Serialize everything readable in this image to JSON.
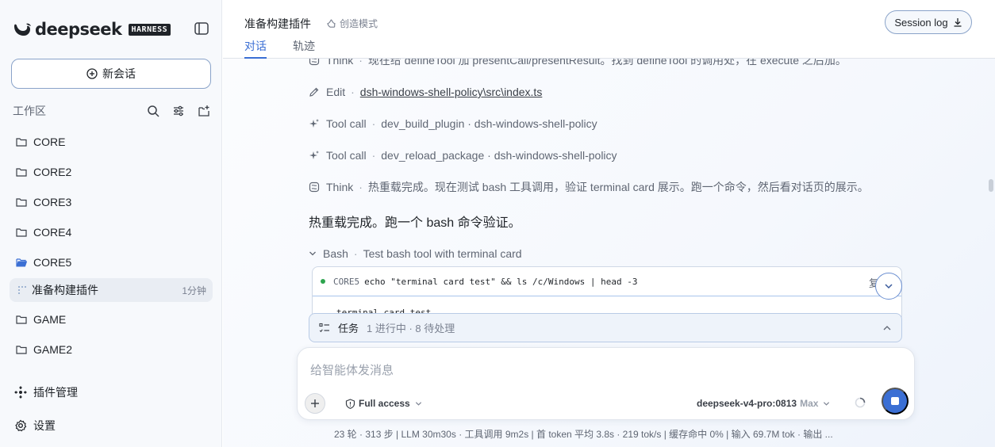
{
  "brand": {
    "name": "deepseek",
    "badge": "HARNESS"
  },
  "sidebar": {
    "new_chat_label": "新会话",
    "workspace_title": "工作区",
    "folders": [
      {
        "label": "CORE",
        "open": false
      },
      {
        "label": "CORE2",
        "open": false
      },
      {
        "label": "CORE3",
        "open": false
      },
      {
        "label": "CORE4",
        "open": false
      },
      {
        "label": "CORE5",
        "open": true
      }
    ],
    "active_session": {
      "title": "准备构建插件",
      "time": "1分钟"
    },
    "folders_after": [
      {
        "label": "GAME"
      },
      {
        "label": "GAME2"
      }
    ],
    "plugin_manager_label": "插件管理",
    "settings_label": "设置"
  },
  "header": {
    "title": "准备构建插件",
    "mode_label": "创造模式",
    "session_log_label": "Session log",
    "tabs": [
      "对话",
      "轨迹"
    ]
  },
  "steps": [
    {
      "icon": "brain-icon",
      "kind": "Think",
      "text": "现在给 defineTool 加 presentCall/presentResult。找到 defineTool 的调用处，在 execute 之后加。"
    },
    {
      "icon": "pencil-icon",
      "kind": "Edit",
      "text": "dsh-windows-shell-policy\\src\\index.ts"
    },
    {
      "icon": "sparkle-icon",
      "kind": "Tool call",
      "text": "dev_build_plugin · dsh-windows-shell-policy"
    },
    {
      "icon": "sparkle-icon",
      "kind": "Tool call",
      "text": "dev_reload_package · dsh-windows-shell-policy"
    },
    {
      "icon": "brain-icon",
      "kind": "Think",
      "text": "热重载完成。现在测试 bash 工具调用，验证 terminal card 展示。跑一个命令，然后看对话页的展示。"
    }
  ],
  "reply": "热重载完成。跑一个 bash 命令验证。",
  "bash": {
    "kind": "Bash",
    "description": "Test bash tool with terminal card",
    "cwd": "CORE5",
    "command": "echo \"terminal card test\" && ls /c/Windows | head -3",
    "copy_label": "复",
    "output": "terminal card test"
  },
  "tasks": {
    "title": "任务",
    "meta": "1 进行中 · 8 待处理"
  },
  "composer": {
    "placeholder": "给智能体发消息",
    "access_label": "Full access",
    "model": "deepseek-v4-pro:0813",
    "level": "Max"
  },
  "status": "23 轮 · 313 步   |   LLM 30m30s · 工具调用 9m2s   |   首 token 平均 3.8s · 219 tok/s   |   缓存命中 0%   |   输入 69.7M tok · 输出 ..."
}
